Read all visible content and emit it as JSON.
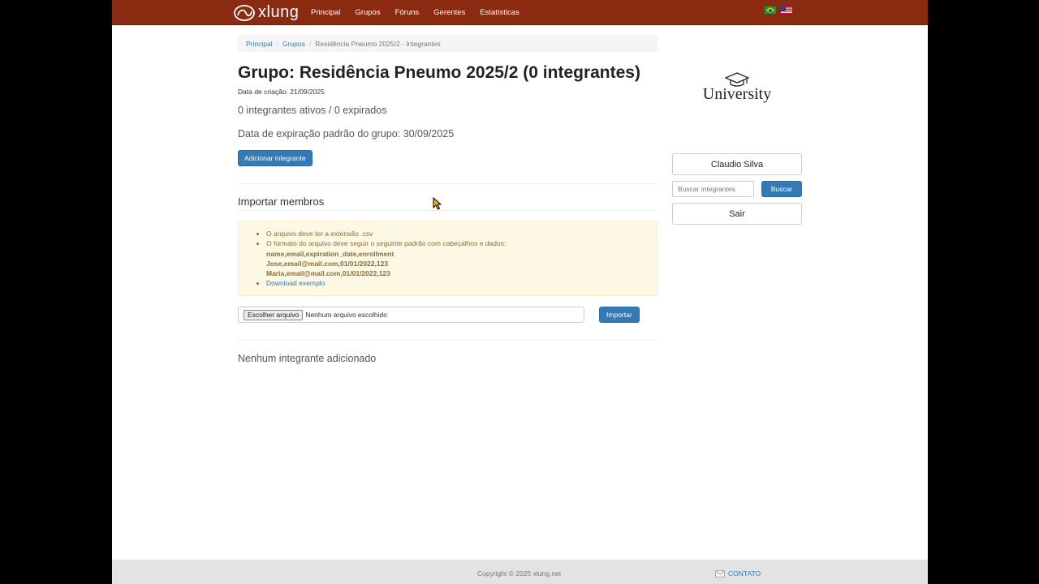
{
  "brand": {
    "name": "xlung"
  },
  "nav": {
    "items": [
      "Principal",
      "Grupos",
      "Fóruns",
      "Gerentes",
      "Estatísticas"
    ]
  },
  "languages": [
    {
      "icon": "brazil-flag-icon"
    },
    {
      "icon": "usa-flag-icon"
    }
  ],
  "breadcrumb": {
    "home": "Principal",
    "groups": "Grupos",
    "current": "Residência Pneumo 2025/2 - Integrantes"
  },
  "group": {
    "title": "Grupo: Residência Pneumo 2025/2 (0 integrantes)",
    "created": "Data de criação: 21/09/2025",
    "stats": "0 integrantes ativos / 0 expirados",
    "expiry": "Data de expiração padrão do grupo: 30/09/2025",
    "add_label": "Adicionar integrante"
  },
  "import": {
    "title": "Importar membros",
    "rule_extension": "O arquivo deve ter a extensão .csv",
    "rule_format": "O formato do arquivo deve seguir o seguinte padrão com cabeçalhos e dados:",
    "format_lines": [
      "name,email,expiration_date,enrollment",
      "Jose,email@mail.com,01/01/2022,123",
      "Maria,email@mail.com,01/01/2022,123"
    ],
    "download_label": "Download exemplo",
    "file_button": "Escolher arquivo",
    "file_status": "Nenhum arquivo escolhido",
    "submit_label": "Importar"
  },
  "members": {
    "empty_text": "Nenhum integrante adicionado"
  },
  "sidebar": {
    "logo_text": "University",
    "user_name": "Claudio Silva",
    "search_placeholder": "Buscar integrantes",
    "search_button": "Buscar",
    "logout_label": "Sair"
  },
  "footer": {
    "copyright": "Copyright © 2025 xlung.net",
    "contact_label": "CONTATO"
  },
  "colors": {
    "navbar": "#8a2a10",
    "primary": "#337ab7",
    "warning_bg": "#fcf8e3",
    "warning_text": "#8a6d3b"
  }
}
